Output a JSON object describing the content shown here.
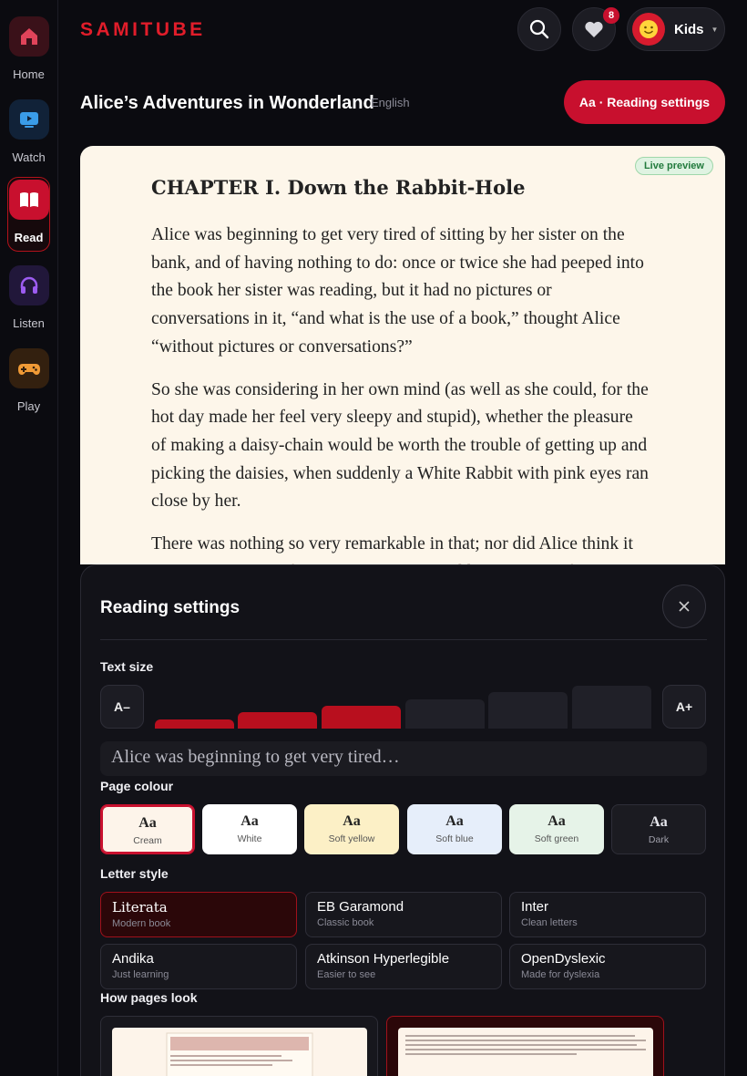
{
  "sidebar": {
    "items": [
      {
        "label": "Home",
        "icon": "home-icon",
        "color": "#e0445a",
        "bg": "#3a1119"
      },
      {
        "label": "Watch",
        "icon": "tv-icon",
        "color": "#3a9ce8",
        "bg": "#112238"
      },
      {
        "label": "Read",
        "icon": "book-icon",
        "color": "#ffffff",
        "bg": "#c8102e",
        "active": true
      },
      {
        "label": "Listen",
        "icon": "headphones-icon",
        "color": "#9c5cf0",
        "bg": "#21173a"
      },
      {
        "label": "Play",
        "icon": "gamepad-icon",
        "color": "#f09a36",
        "bg": "#33200f"
      }
    ]
  },
  "header": {
    "logo": "SAMITUBE",
    "favorites_badge": "8",
    "profile_name": "Kids"
  },
  "book": {
    "title": "Alice’s Adventures in Wonderland",
    "language": "English",
    "settings_button": "Aa · Reading settings"
  },
  "reader": {
    "live_badge": "Live preview",
    "chapter": "CHAPTER I. Down the Rabbit-Hole",
    "paragraphs": [
      "Alice was beginning to get very tired of sitting by her sister on the bank, and of having nothing to do: once or twice she had peeped into the book her sister was reading, but it had no pictures or conversations in it, “and what is the use of a book,” thought Alice “without pictures or conversations?”",
      "So she was considering in her own mind (as well as she could, for the hot day made her feel very sleepy and stupid), whether the pleasure of making a daisy-chain would be worth the trouble of getting up and picking the daisies, when suddenly a White Rabbit with pink eyes ran close by her.",
      "There was nothing so very remarkable in that; nor did Alice think it so very much out of the way to hear the Rabbit say to itself."
    ]
  },
  "settings": {
    "title": "Reading settings",
    "text_size": {
      "label": "Text size",
      "decrease": "A–",
      "increase": "A+",
      "steps": 6,
      "selected": 3
    },
    "sample_text": "Alice was beginning to get very tired…",
    "page_colour": {
      "label": "Page colour",
      "options": [
        {
          "name": "Cream",
          "bg": "#fdf4ea",
          "fg": "#222222",
          "selected": true
        },
        {
          "name": "White",
          "bg": "#ffffff",
          "fg": "#222222"
        },
        {
          "name": "Soft yellow",
          "bg": "#fcf0c6",
          "fg": "#222222"
        },
        {
          "name": "Soft blue",
          "bg": "#e6eefa",
          "fg": "#222222"
        },
        {
          "name": "Soft green",
          "bg": "#e6f3e8",
          "fg": "#222222"
        },
        {
          "name": "Dark",
          "bg": "#1b1b21",
          "fg": "#e8e8ee"
        }
      ],
      "sample": "Aa"
    },
    "letter_style": {
      "label": "Letter style",
      "options": [
        {
          "name": "Literata",
          "desc": "Modern book",
          "selected": true
        },
        {
          "name": "EB Garamond",
          "desc": "Classic book"
        },
        {
          "name": "Inter",
          "desc": "Clean letters"
        },
        {
          "name": "Andika",
          "desc": "Just learning"
        },
        {
          "name": "Atkinson Hyperlegible",
          "desc": "Easier to see"
        },
        {
          "name": "OpenDyslexic",
          "desc": "Made for dyslexia"
        }
      ]
    },
    "page_look": {
      "label": "How pages look"
    }
  }
}
